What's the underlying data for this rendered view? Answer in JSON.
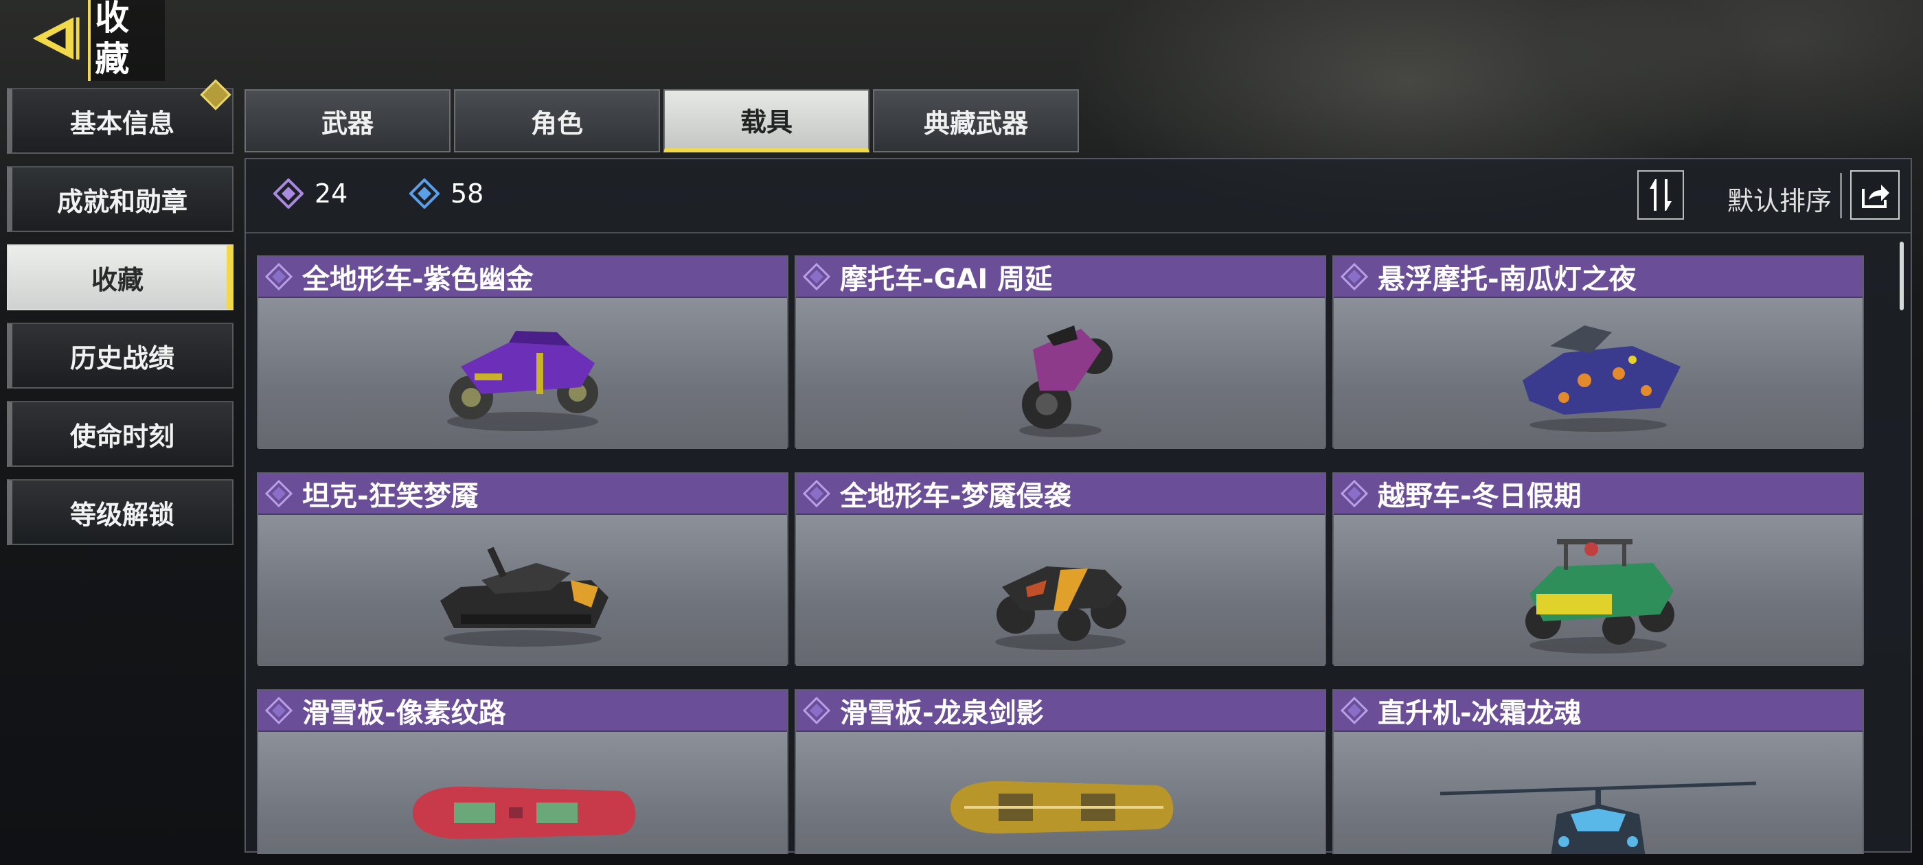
{
  "header": {
    "title": "收藏",
    "back_icon": "back-arrow-icon"
  },
  "sidebar": {
    "items": [
      {
        "label": "基本信息",
        "badge": true
      },
      {
        "label": "成就和勋章"
      },
      {
        "label": "收藏",
        "active": true
      },
      {
        "label": "历史战绩"
      },
      {
        "label": "使命时刻"
      },
      {
        "label": "等级解锁"
      }
    ]
  },
  "tabs": [
    {
      "label": "武器"
    },
    {
      "label": "角色"
    },
    {
      "label": "载具",
      "active": true
    },
    {
      "label": "典藏武器"
    }
  ],
  "stats": {
    "purple_count": "24",
    "blue_count": "58"
  },
  "sort": {
    "label": "默认排序",
    "icon": "sort-icon"
  },
  "share_icon": "share-icon",
  "colors": {
    "accent": "#f2d94a",
    "rarity_purple": "#6a4f98",
    "rarity_blue": "#4a8fd8"
  },
  "cards": [
    {
      "name": "全地形车-紫色幽金",
      "vehicle": "atv",
      "tint": "#6b2fb8",
      "trim": "#c9b12a"
    },
    {
      "name": "摩托车-GAI 周延",
      "vehicle": "motorcycle",
      "tint": "#8d3a8a",
      "trim": "#222"
    },
    {
      "name": "悬浮摩托-南瓜灯之夜",
      "vehicle": "hoverbike",
      "tint": "#3a3b8f",
      "trim": "#e38a2a"
    },
    {
      "name": "坦克-狂笑梦魇",
      "vehicle": "tank",
      "tint": "#2a2a2a",
      "trim": "#e0a02a"
    },
    {
      "name": "全地形车-梦魇侵袭",
      "vehicle": "atv",
      "tint": "#2a2a2a",
      "trim": "#e0a02a"
    },
    {
      "name": "越野车-冬日假期",
      "vehicle": "buggy",
      "tint": "#2f8f5a",
      "trim": "#e0d22a"
    },
    {
      "name": "滑雪板-像素纹路",
      "vehicle": "snowboard",
      "tint": "#c83a4a",
      "trim": "#6aa87a"
    },
    {
      "name": "滑雪板-龙泉剑影",
      "vehicle": "snowboard",
      "tint": "#b8962a",
      "trim": "#6b5a2a"
    },
    {
      "name": "直升机-冰霜龙魂",
      "vehicle": "helicopter",
      "tint": "#2f3a48",
      "trim": "#5ab8e8"
    }
  ]
}
